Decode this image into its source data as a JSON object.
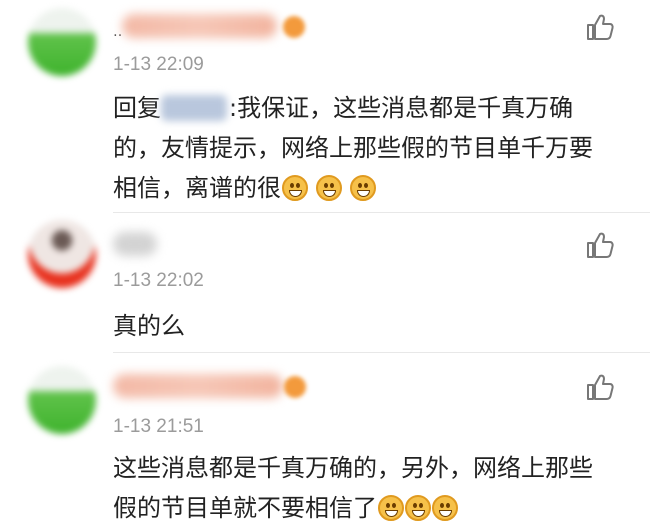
{
  "comments": [
    {
      "time": "1-13 22:09",
      "mention_prefix": "回复",
      "lines": [
        ":我保证，这些消息都是千真万确",
        "的，友情提示，网络上那些假的节目单千万要",
        "相信，离谱的很"
      ],
      "emoji_count": 3,
      "avatar": "green-avatar",
      "like_icon": "thumbs-up-icon"
    },
    {
      "time": "1-13 22:02",
      "lines": [
        "真的么"
      ],
      "emoji_count": 0,
      "avatar": "person-avatar",
      "like_icon": "thumbs-up-icon"
    },
    {
      "time": "1-13 21:51",
      "lines": [
        "这些消息都是千真万确的，另外，网络上那些",
        "假的节目单就不要相信了"
      ],
      "emoji_count": 3,
      "avatar": "green-avatar",
      "like_icon": "thumbs-up-icon"
    }
  ],
  "colors": {
    "time": "#9b9b9b",
    "text": "#222222",
    "divider": "#e8e8e8",
    "emoji": "#f6c14a"
  }
}
